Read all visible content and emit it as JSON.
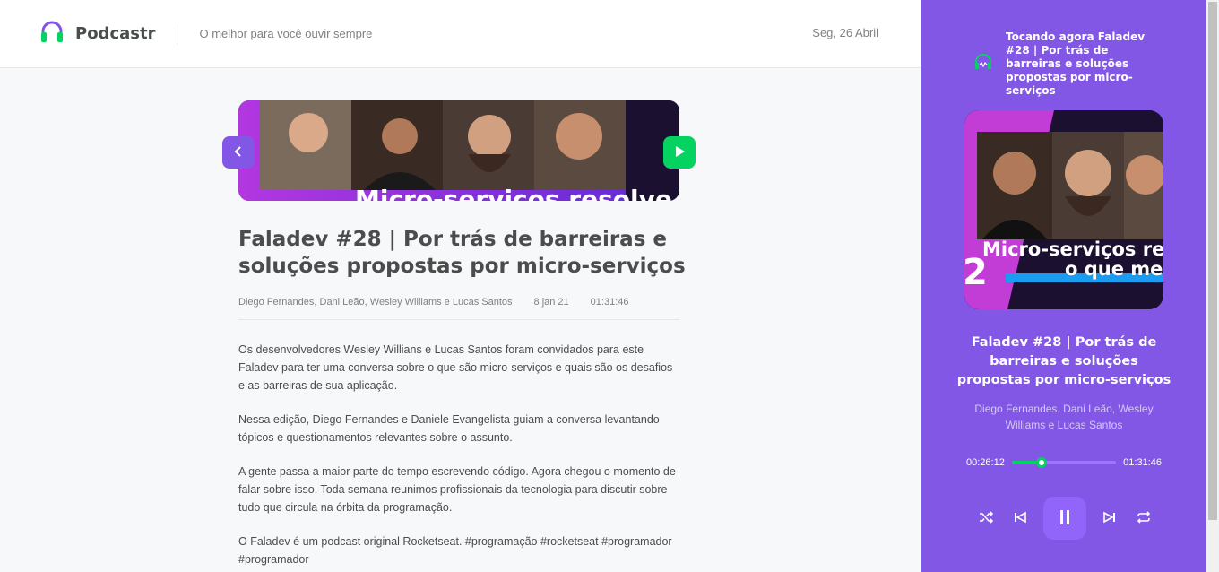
{
  "header": {
    "logo_text": "Podcastr",
    "tagline": "O melhor para você ouvir sempre",
    "date": "Seg, 26 Abril"
  },
  "episode": {
    "thumbnail_text": "Micro-serviços resolve",
    "title": "Faladev #28 | Por trás de barreiras e soluções propostas por micro-serviços",
    "members": "Diego Fernandes, Dani Leão, Wesley Williams e Lucas Santos",
    "published_at": "8 jan 21",
    "duration": "01:31:46",
    "description": [
      "Os desenvolvedores Wesley Willians e Lucas Santos foram convidados para este Faladev para ter uma conversa sobre o que são micro-serviços e quais são os desafios e as barreiras de sua aplicação.",
      "Nessa edição, Diego Fernandes e Daniele Evangelista guiam a conversa levantando tópicos e questionamentos relevantes sobre o assunto.",
      "A gente passa a maior parte do tempo escrevendo código. Agora chegou o momento de falar sobre isso. Toda semana reunimos profissionais da tecnologia para discutir sobre tudo que circula na órbita da programação.",
      "O Faladev é um podcast original Rocketseat. #programação #rocketseat #programador #programador"
    ]
  },
  "player": {
    "now_playing": "Tocando agora Faladev #28 | Por trás de barreiras e soluções propostas por micro-serviços",
    "cover_text_line1": "Micro-serviços re",
    "cover_text_line2": "o que me",
    "cover_number": "2",
    "title": "Faladev #28 | Por trás de barreiras e soluções propostas por micro-serviços",
    "members": "Diego Fernandes, Dani Leão, Wesley Williams e Lucas Santos",
    "current_time": "00:26:12",
    "total_time": "01:31:46",
    "progress_fraction": 0.285
  },
  "colors": {
    "purple": "#8257e5",
    "green": "#04d361"
  },
  "icons": {
    "logo": "headphones-icon",
    "back": "arrow-left-icon",
    "play": "play-icon",
    "now_playing": "now-playing-icon",
    "shuffle": "shuffle-icon",
    "previous": "previous-icon",
    "pause": "pause-icon",
    "next": "next-icon",
    "repeat": "repeat-icon"
  }
}
